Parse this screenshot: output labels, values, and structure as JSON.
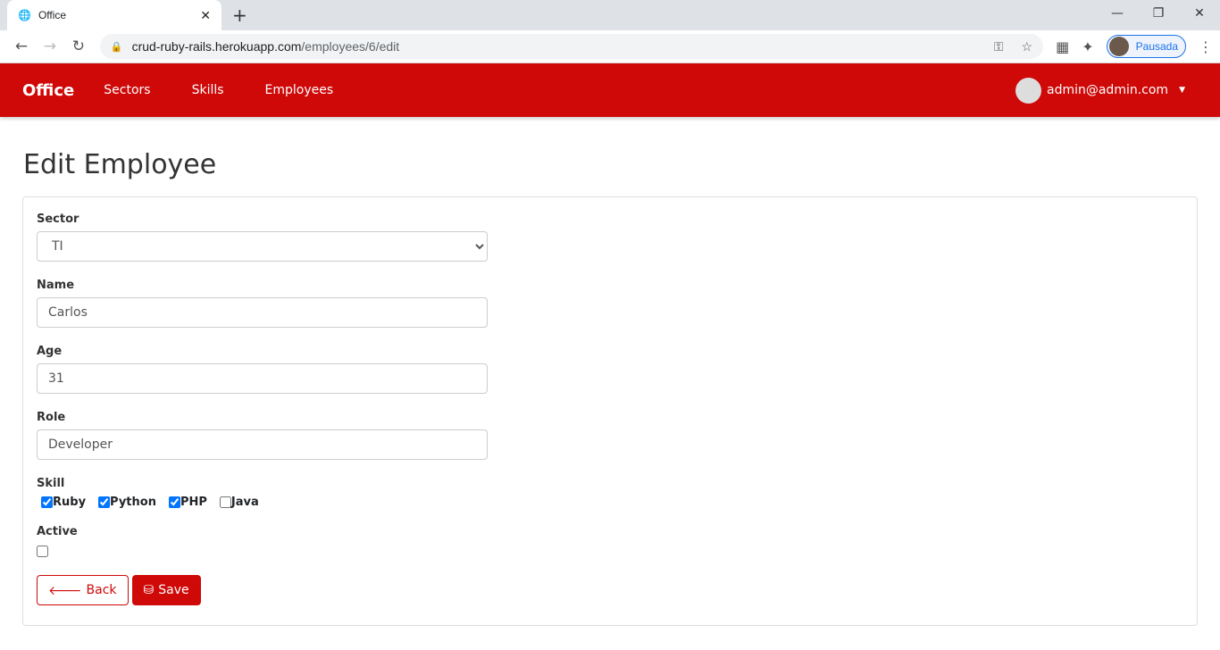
{
  "browser": {
    "tab_title": "Office",
    "url_host": "crud-ruby-rails.herokuapp.com",
    "url_path": "/employees/6/edit",
    "profile_label": "Pausada"
  },
  "navbar": {
    "brand": "Office",
    "links": [
      "Sectors",
      "Skills",
      "Employees"
    ],
    "user": "admin@admin.com",
    "color": "#cf0808"
  },
  "page": {
    "title": "Edit Employee"
  },
  "form": {
    "sector": {
      "label": "Sector",
      "value": "TI"
    },
    "name": {
      "label": "Name",
      "value": "Carlos"
    },
    "age": {
      "label": "Age",
      "value": "31"
    },
    "role": {
      "label": "Role",
      "value": "Developer"
    },
    "skill": {
      "label": "Skill",
      "options": [
        {
          "label": "Ruby",
          "checked": true
        },
        {
          "label": "Python",
          "checked": true
        },
        {
          "label": "PHP",
          "checked": true
        },
        {
          "label": "Java",
          "checked": false
        }
      ]
    },
    "active": {
      "label": "Active",
      "checked": false
    },
    "back_label": "Back",
    "save_label": "Save"
  }
}
